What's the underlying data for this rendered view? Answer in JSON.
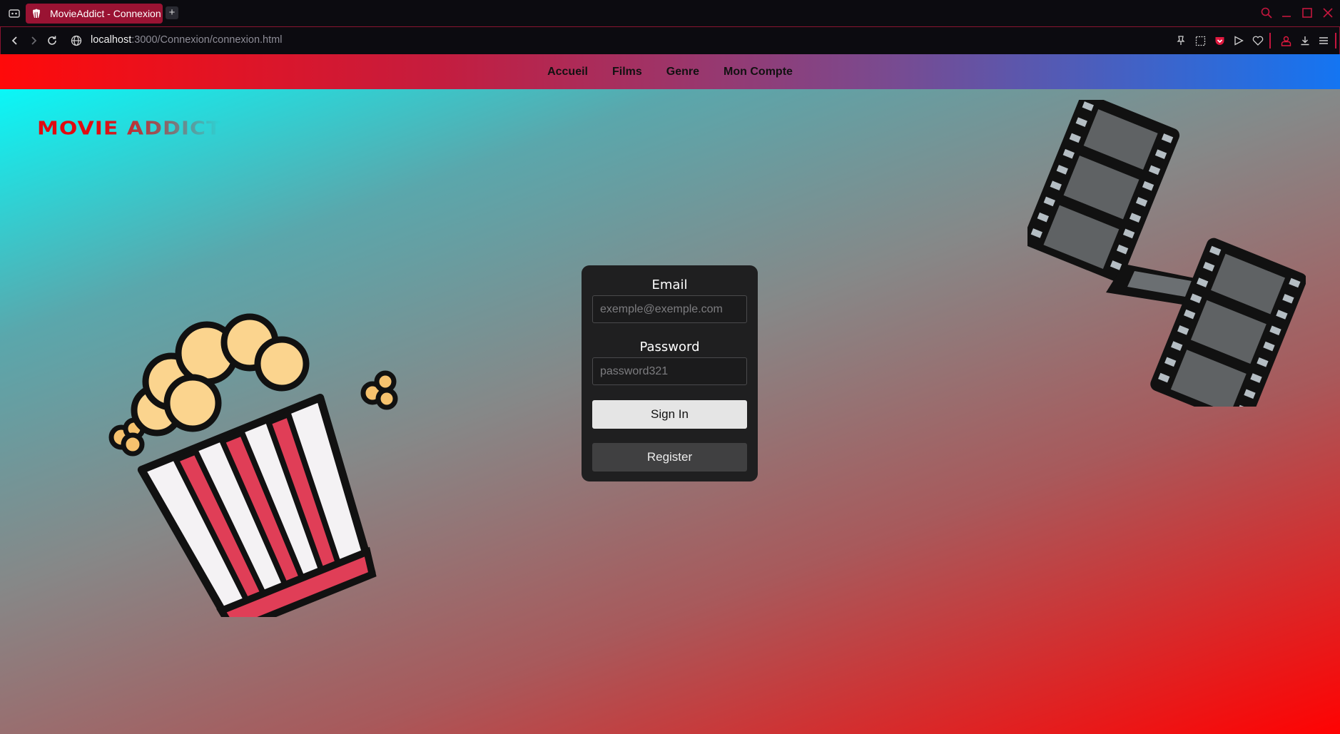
{
  "browser": {
    "tab": {
      "title": "MovieAddict - Connexion"
    },
    "new_tab_label": "+",
    "url": {
      "host": "localhost",
      "path": ":3000/Connexion/connexion.html"
    },
    "accent_color": "#c4163e"
  },
  "site": {
    "logo_text": "MOVIE ADDICT",
    "nav": [
      {
        "label": "Accueil"
      },
      {
        "label": "Films"
      },
      {
        "label": "Genre"
      },
      {
        "label": "Mon Compte"
      }
    ],
    "gradient_colors": {
      "navbar": [
        "#ff0a0a",
        "#1475f2"
      ],
      "hero": [
        "#0af7f7",
        "#ff0202"
      ]
    }
  },
  "login": {
    "email_label": "Email",
    "email_placeholder": "exemple@exemple.com",
    "password_label": "Password",
    "password_placeholder": "password321",
    "signin_label": "Sign In",
    "register_label": "Register"
  }
}
